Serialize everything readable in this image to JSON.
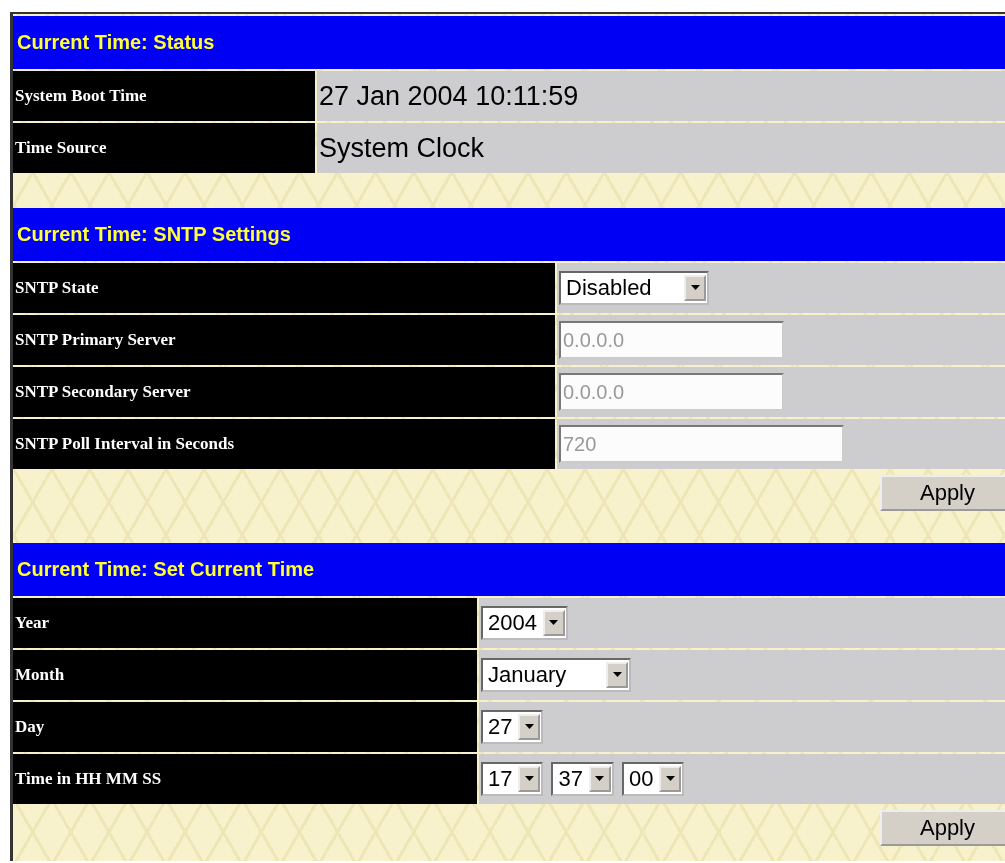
{
  "sections": [
    {
      "title": "Current Time: Status",
      "rows": [
        {
          "label": "System Boot Time",
          "kind": "text",
          "value": "27 Jan 2004 10:11:59"
        },
        {
          "label": "Time Source",
          "kind": "text",
          "value": "System Clock"
        }
      ]
    },
    {
      "title": "Current Time: SNTP Settings",
      "rows": [
        {
          "label": "SNTP State",
          "kind": "select",
          "selects": [
            "Disabled"
          ]
        },
        {
          "label": "SNTP Primary Server",
          "kind": "input",
          "value": "0.0.0.0",
          "disabled": true
        },
        {
          "label": "SNTP Secondary Server",
          "kind": "input",
          "value": "0.0.0.0",
          "disabled": true
        },
        {
          "label": "SNTP Poll Interval in Seconds",
          "kind": "input",
          "value": "720",
          "disabled": true
        }
      ],
      "button": "Apply"
    },
    {
      "title": "Current Time: Set Current Time",
      "rows": [
        {
          "label": "Year",
          "kind": "select",
          "selects": [
            "2004"
          ]
        },
        {
          "label": "Month",
          "kind": "select",
          "selects": [
            "January"
          ]
        },
        {
          "label": "Day",
          "kind": "select",
          "selects": [
            "27"
          ]
        },
        {
          "label": "Time in HH MM SS",
          "kind": "select",
          "selects": [
            "17",
            "37",
            "00"
          ]
        }
      ],
      "button": "Apply"
    }
  ]
}
